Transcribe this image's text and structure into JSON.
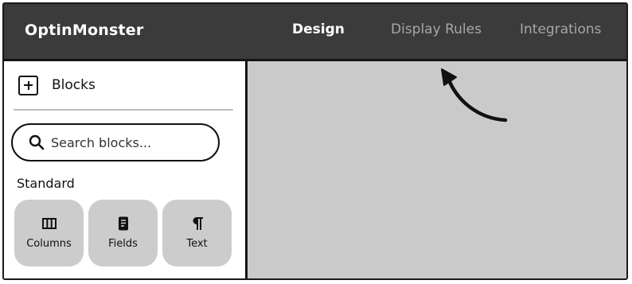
{
  "header": {
    "brand": "OptinMonster",
    "tabs": [
      {
        "label": "Design",
        "active": true
      },
      {
        "label": "Display Rules",
        "active": false
      },
      {
        "label": "Integrations",
        "active": false
      }
    ]
  },
  "sidebar": {
    "blocks_label": "Blocks",
    "search": {
      "placeholder": "Search blocks..."
    },
    "section_title": "Standard",
    "blocks": [
      {
        "label": "Columns",
        "icon": "columns-icon"
      },
      {
        "label": "Fields",
        "icon": "fields-icon"
      },
      {
        "label": "Text",
        "icon": "pilcrow-icon"
      }
    ]
  },
  "colors": {
    "header_bg": "#3b3b3b",
    "active_tab": "#ffffff",
    "inactive_tab": "#a6a6a6",
    "tile_bg": "#cccccc",
    "canvas_bg": "#cacaca"
  }
}
